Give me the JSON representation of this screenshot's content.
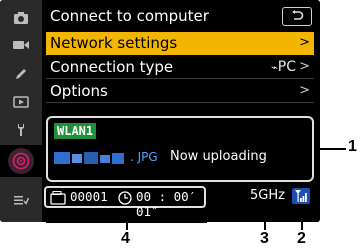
{
  "title": "Connect to computer",
  "menu_items": [
    {
      "label": "Network settings",
      "value": ""
    },
    {
      "label": "Connection type",
      "value": "PC"
    },
    {
      "label": "Options",
      "value": ""
    }
  ],
  "status": {
    "ssid": "WLAN1",
    "file_ext": ". JPG",
    "upload_text": "Now uploading"
  },
  "bottom": {
    "counter": "00001",
    "time": "00 : 00′ 01″",
    "band": "5GHz"
  },
  "callouts": [
    "1",
    "2",
    "3",
    "4"
  ],
  "colors": {
    "highlight": "#f2b600",
    "ssid_bg": "#1f8f3a",
    "file_blue": "#4ea3ff",
    "signal_blue": "#3a8cff",
    "active_tab": "#e01e6e"
  },
  "icons": [
    "camera-icon",
    "movie-icon",
    "pencil-icon",
    "playback-icon",
    "wrench-icon",
    "network-icon",
    "mymenu-icon",
    "back-icon",
    "chevron-right-icon",
    "pc-connection-icon",
    "counter-icon",
    "clock-icon",
    "signal-strength-icon"
  ]
}
